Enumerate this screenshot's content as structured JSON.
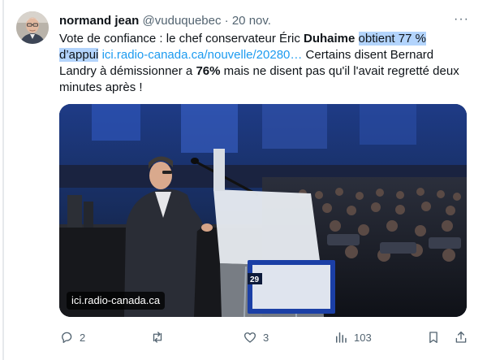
{
  "tweet": {
    "author_name": "normand jean",
    "handle": "@vuduquebec",
    "separator": " · ",
    "date": "20 nov.",
    "more_label": "···",
    "text": {
      "p1": "Vote de confiance : le chef conservateur Éric ",
      "bold1": "Duhaime",
      "space": " ",
      "hl1": "obtient 77 %",
      "hl2": "d’appui",
      "link": "ici.radio-canada.ca/nouvelle/20280…",
      "p2": " Certains disent Bernard Landry à démissionner a ",
      "bold2": "76%",
      "p3": " mais ne disent pas qu'il l'avait regretté deux minutes après !"
    },
    "media": {
      "domain_label": "ici.radio-canada.ca",
      "screen_text": "29"
    },
    "actions": {
      "replies": "2",
      "retweets": "",
      "likes": "3",
      "views": "103"
    }
  },
  "colors": {
    "accent": "#1d9bf0",
    "muted": "#536471",
    "highlight": "#b3d4fc"
  }
}
